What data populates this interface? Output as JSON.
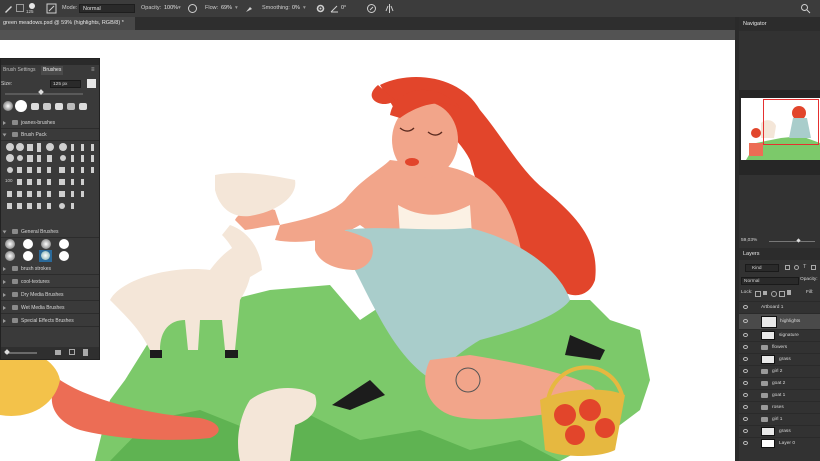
{
  "options_bar": {
    "brush_size": "125",
    "mode_label": "Mode:",
    "mode_value": "Normal",
    "opacity_label": "Opacity:",
    "opacity_value": "100%",
    "flow_label": "Flow:",
    "flow_value": "69%",
    "smoothing_label": "Smoothing:",
    "smoothing_value": "0%",
    "angle_value": "0°"
  },
  "document": {
    "tab_title": "green meadows.psd @ 59% (highlights, RGB/8) *"
  },
  "brush_panel": {
    "tabs": [
      "Brush Settings",
      "Brushes"
    ],
    "size_label": "Size:",
    "size_value": "125 px",
    "groups": [
      "joanes-brushes",
      "Brush Pack",
      "General Brushes",
      "brush strokes",
      "cool-textures",
      "Dry Media Brushes",
      "Wet Media Brushes",
      "Special Effects Brushes"
    ],
    "preset_number": "100"
  },
  "navigator": {
    "title": "Navigator",
    "zoom": "59,03%"
  },
  "layers": {
    "title": "Layers",
    "kind_label": "Kind",
    "blend_mode": "Normal",
    "opacity_label": "Opacity:",
    "lock_label": "Lock:",
    "fill_label": "Fill:",
    "artboard": "Artboard 1",
    "items": [
      "highlights",
      "signature",
      "flowers",
      "grass",
      "girl 2",
      "goat 2",
      "goat 1",
      "roses",
      "girl 1",
      "grass",
      "Layer 0"
    ]
  },
  "colors": {
    "app_bg": "#535353",
    "panel_bg": "#323232",
    "canvas_bg": "#ffffff",
    "hair": "#e2452b",
    "skin": "#f2a58a",
    "dress": "#a9cdcb",
    "grass": "#7cc96a",
    "goat": "#f4e6d8"
  }
}
